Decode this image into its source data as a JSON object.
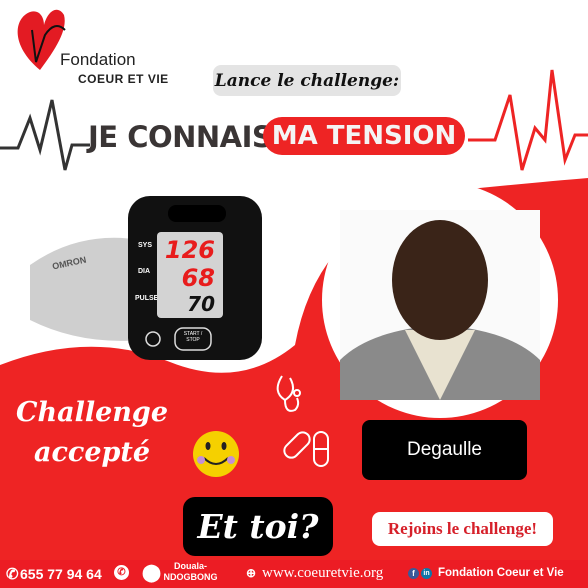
{
  "logo": {
    "line1": "Fondation",
    "line2": "COEUR ET VIE"
  },
  "header": {
    "intro": "Lance le challenge:",
    "title_part1": "JE CONNAIS",
    "title_part2": "MA TENSION"
  },
  "monitor": {
    "brand": "OMRON",
    "sys_label": "SYS",
    "dia_label": "DIA",
    "pulse_label": "PULSE",
    "sys": "126",
    "dia": "68",
    "pulse": "70",
    "button": "START / STOP"
  },
  "challenge": {
    "text": "Challenge accepté",
    "participant": "Degaulle",
    "cta_question": "Et toi?",
    "cta_button": "Rejoins le challenge!"
  },
  "footer": {
    "phone": "655 77 94 64",
    "location_line1": "Douala-",
    "location_line2": "NDOGBONG",
    "website": "www.coeuretvie.org",
    "social": "Fondation Coeur et Vie"
  },
  "colors": {
    "red": "#ee2424",
    "black": "#000000",
    "white": "#ffffff"
  }
}
